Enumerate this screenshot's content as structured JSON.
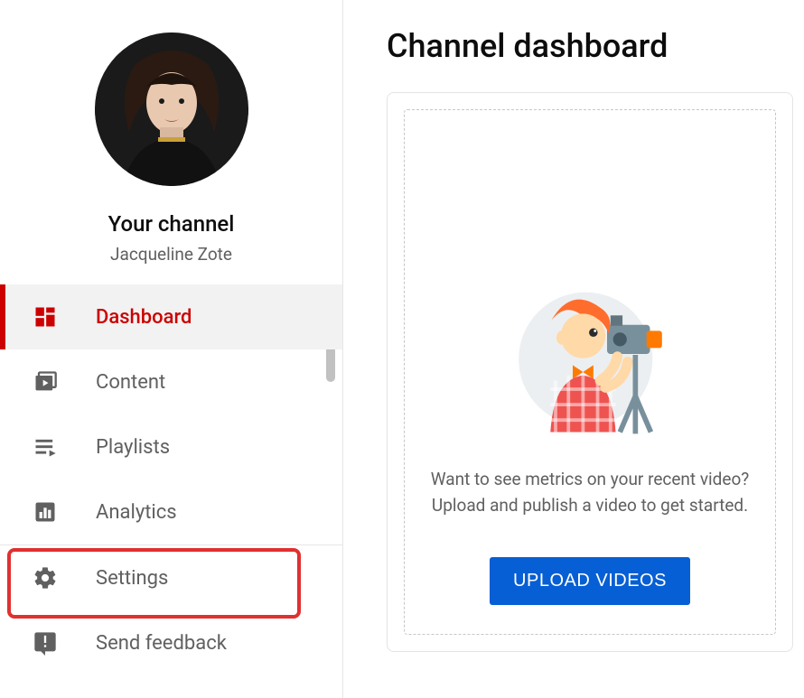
{
  "sidebar": {
    "profile_heading": "Your channel",
    "channel_name": "Jacqueline Zote",
    "items": [
      {
        "label": "Dashboard",
        "icon": "dashboard-icon"
      },
      {
        "label": "Content",
        "icon": "content-icon"
      },
      {
        "label": "Playlists",
        "icon": "playlists-icon"
      },
      {
        "label": "Analytics",
        "icon": "analytics-icon"
      }
    ],
    "footer_items": [
      {
        "label": "Settings",
        "icon": "settings-icon"
      },
      {
        "label": "Send feedback",
        "icon": "feedback-icon"
      }
    ]
  },
  "main": {
    "page_title": "Channel dashboard",
    "card": {
      "line1": "Want to see metrics on your recent video?",
      "line2": "Upload and publish a video to get started.",
      "button": "UPLOAD VIDEOS"
    }
  }
}
